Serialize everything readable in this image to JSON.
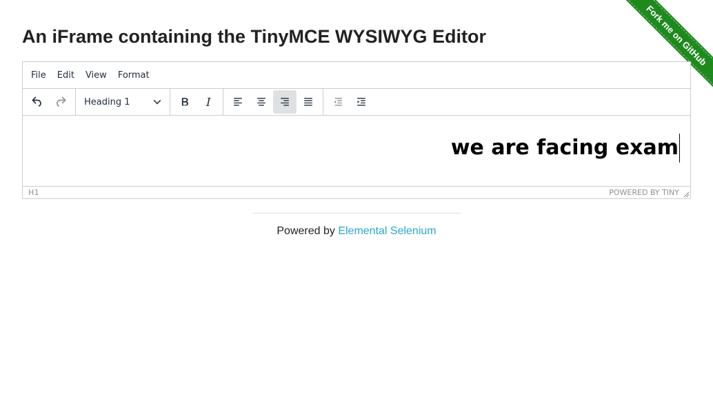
{
  "page": {
    "title": "An iFrame containing the TinyMCE WYSIWYG Editor"
  },
  "ribbon": {
    "label": "Fork me on GitHub",
    "color": "#1e8a1e"
  },
  "editor": {
    "menubar": {
      "items": [
        {
          "label": "File"
        },
        {
          "label": "Edit"
        },
        {
          "label": "View"
        },
        {
          "label": "Format"
        }
      ]
    },
    "toolbar": {
      "history": [
        {
          "icon": "undo-icon",
          "enabled": true
        },
        {
          "icon": "redo-icon",
          "enabled": false
        }
      ],
      "block_format": {
        "selected": "Heading 1",
        "icon": "chevron-down-icon"
      },
      "formatting": [
        {
          "icon": "bold-icon"
        },
        {
          "icon": "italic-icon"
        }
      ],
      "alignment": [
        {
          "icon": "align-left-icon",
          "active": false
        },
        {
          "icon": "align-center-icon",
          "active": false
        },
        {
          "icon": "align-right-icon",
          "active": true
        },
        {
          "icon": "align-justify-icon",
          "active": false
        }
      ],
      "indent": [
        {
          "icon": "outdent-icon",
          "enabled": false
        },
        {
          "icon": "indent-icon",
          "enabled": true
        }
      ]
    },
    "content": {
      "heading_text": "we are facing exam",
      "alignment": "right"
    },
    "statusbar": {
      "element_path": "H1",
      "branding": "POWERED BY TINY"
    }
  },
  "footer": {
    "prefix": "Powered by ",
    "link_text": "Elemental Selenium",
    "link_color": "#2ba6cb"
  }
}
